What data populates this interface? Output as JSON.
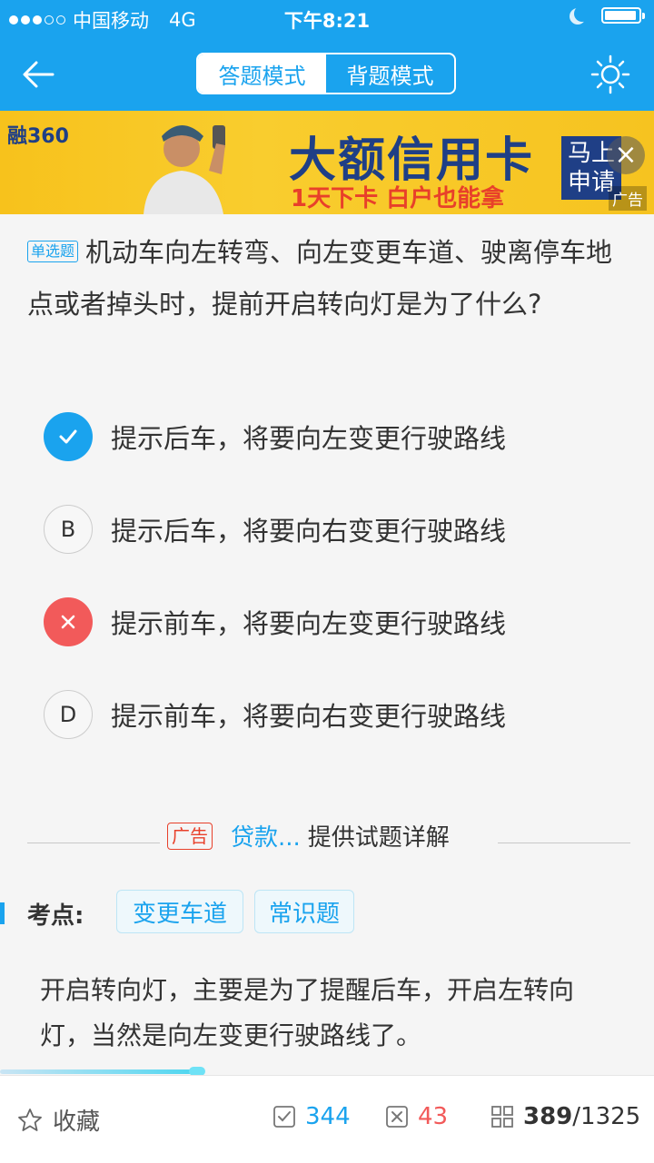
{
  "status_bar": {
    "carrier": "中国移动",
    "network": "4G",
    "time": "下午8:21"
  },
  "nav": {
    "mode_answer": "答题模式",
    "mode_memorize": "背题模式",
    "active_mode": "答题模式"
  },
  "banner": {
    "brand": "融360",
    "title": "大额信用卡",
    "subtitle": "1天下卡 白户也能拿",
    "apply": "马上申请",
    "ad_label": "广告"
  },
  "question": {
    "type_tag": "单选题",
    "text": "机动车向左转弯、向左变更车道、驶离停车地点或者掉头时，提前开启转向灯是为了什么?",
    "options": [
      {
        "letter": "A",
        "text": "提示后车，将要向左变更行驶路线",
        "state": "correct"
      },
      {
        "letter": "B",
        "text": "提示后车，将要向右变更行驶路线",
        "state": "normal"
      },
      {
        "letter": "C",
        "text": "提示前车，将要向左变更行驶路线",
        "state": "wrong"
      },
      {
        "letter": "D",
        "text": "提示前车，将要向右变更行驶路线",
        "state": "normal"
      }
    ]
  },
  "explanation_header": {
    "ad_tag": "广告",
    "link": "贷款...",
    "text": "提供试题详解"
  },
  "key_points": {
    "label": "考点:",
    "tags": [
      "变更车道",
      "常识题"
    ]
  },
  "explanation": "开启转向灯，主要是为了提醒后车，开启左转向灯，当然是向左变更行驶路线了。",
  "bottom_bar": {
    "favorite": "收藏",
    "correct_count": "344",
    "wrong_count": "43",
    "current": "389",
    "total": "/1325"
  },
  "colors": {
    "primary": "#1aa3ee",
    "wrong": "#f25a5a"
  }
}
